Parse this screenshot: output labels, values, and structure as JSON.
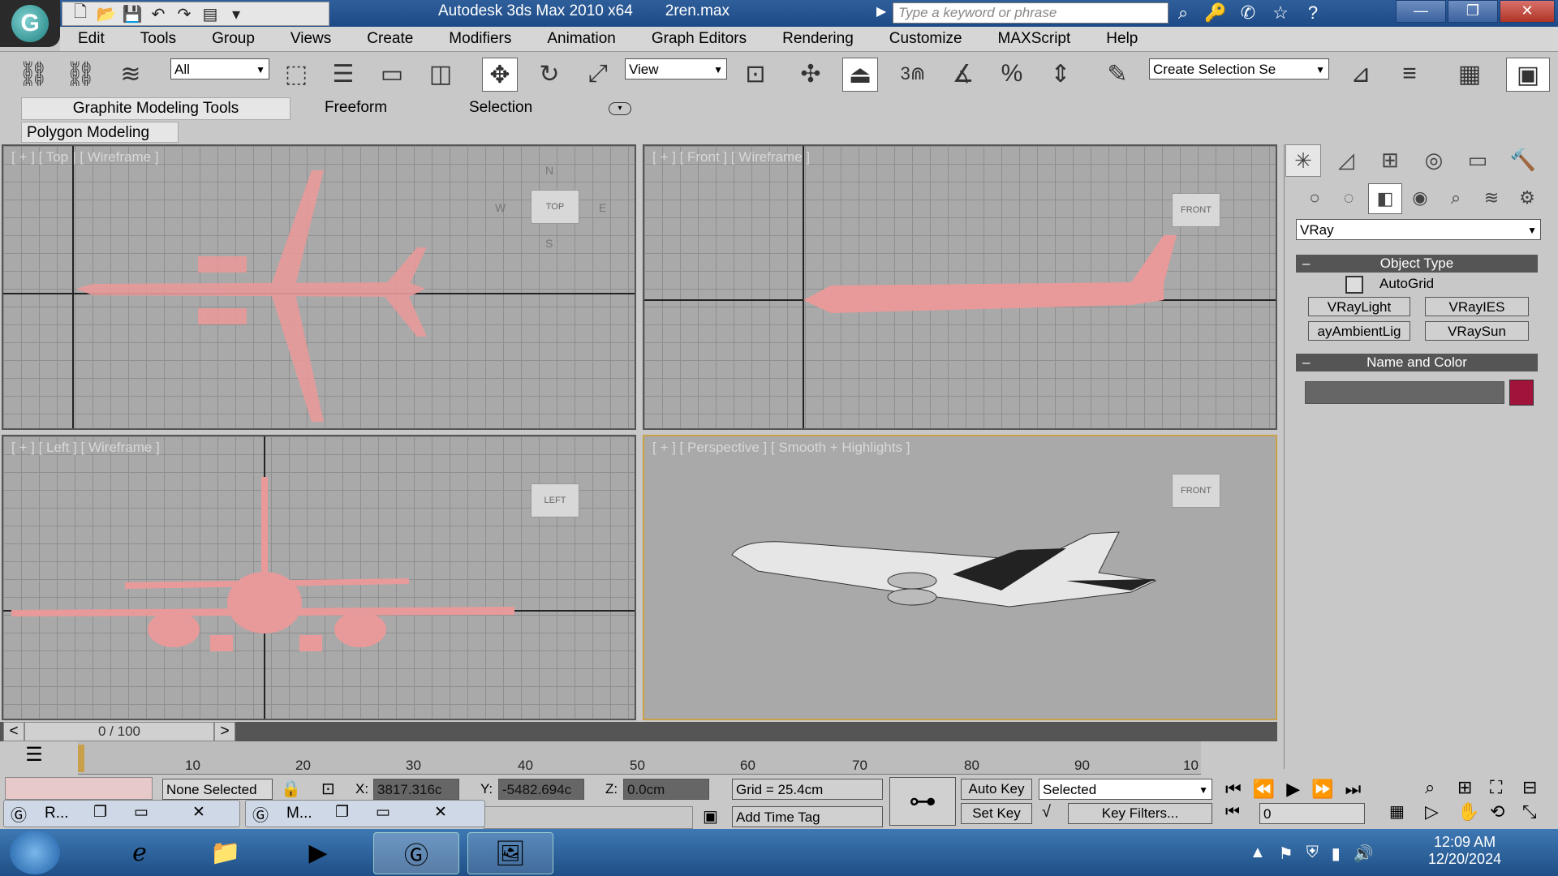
{
  "window": {
    "app_title": "Autodesk 3ds Max  2010 x64",
    "file_name": "2ren.max",
    "search_placeholder": "Type a keyword or phrase"
  },
  "menu": [
    "Edit",
    "Tools",
    "Group",
    "Views",
    "Create",
    "Modifiers",
    "Animation",
    "Graph Editors",
    "Rendering",
    "Customize",
    "MAXScript",
    "Help"
  ],
  "toolbar": {
    "selection_filter": "All",
    "ref_coord": "View",
    "snap_3": "3",
    "named_selection": "Create Selection Se"
  },
  "ribbon": {
    "tabs": [
      "Graphite Modeling Tools",
      "Freeform",
      "Selection"
    ],
    "panel": "Polygon Modeling"
  },
  "viewports": {
    "top": "[ + ] [ Top ] [ Wireframe ]",
    "front": "[ + ] [ Front ] [ Wireframe ]",
    "left": "[ + ] [ Left ] [ Wireframe ]",
    "perspective": "[ + ] [ Perspective ] [ Smooth + Highlights ]",
    "cube_top": "TOP",
    "cube_front": "FRONT",
    "cube_left": "LEFT",
    "cube_persp": "FRONT",
    "compass": {
      "n": "N",
      "s": "S",
      "e": "E",
      "w": "W"
    }
  },
  "command_panel": {
    "category": "VRay",
    "object_type": {
      "header": "Object Type",
      "autogrid": "AutoGrid",
      "buttons": [
        "VRayLight",
        "VRayIES",
        "ayAmbientLig",
        "VRaySun"
      ]
    },
    "name_color": {
      "header": "Name and Color",
      "name_value": "",
      "color": "#a0143c"
    }
  },
  "timeline": {
    "frame": "0 / 100",
    "ticks": [
      "10",
      "20",
      "30",
      "40",
      "50",
      "60",
      "70",
      "80",
      "90",
      "10"
    ],
    "prev": "<",
    "next": ">"
  },
  "status": {
    "selection": "None Selected",
    "x_label": "X:",
    "x_value": "3817.316c",
    "y_label": "Y:",
    "y_value": "-5482.694c",
    "z_label": "Z:",
    "z_value": "0.0cm",
    "grid": "Grid = 25.4cm",
    "add_time_tag": "Add Time Tag",
    "auto_key": "Auto Key",
    "set_key": "Set Key",
    "key_mode": "Selected",
    "key_filters": "Key Filters...",
    "frame_field": "0"
  },
  "mini_windows": [
    {
      "label": "R..."
    },
    {
      "label": "M..."
    }
  ],
  "taskbar": {
    "time": "12:09 AM",
    "date": "12/20/2024"
  },
  "colors": {
    "wire": "#e89a9a",
    "title": "#1d4a86"
  }
}
